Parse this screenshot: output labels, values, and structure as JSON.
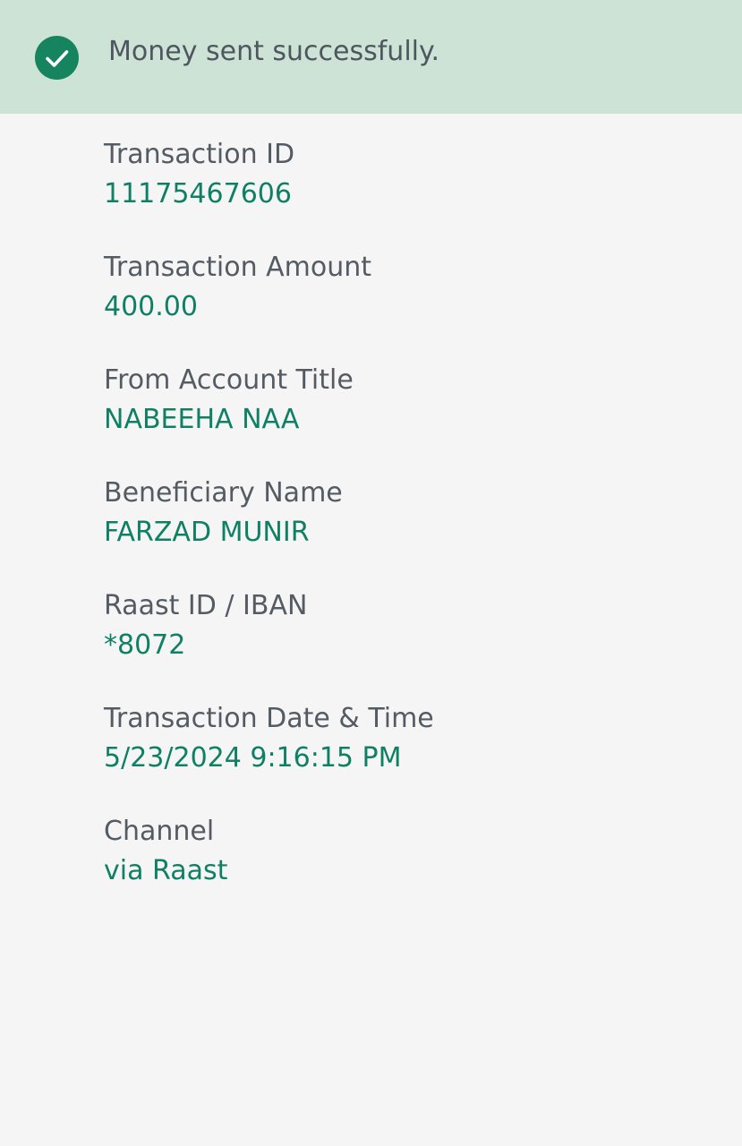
{
  "banner": {
    "message": "Money sent successfully.",
    "icon": "check-circle-icon",
    "background_color": "#cde3d5",
    "icon_color": "#16845f"
  },
  "details": [
    {
      "label": "Transaction ID",
      "value": "11175467606"
    },
    {
      "label": "Transaction Amount",
      "value": "400.00"
    },
    {
      "label": "From Account Title",
      "value": "NABEEHA NAA"
    },
    {
      "label": "Beneficiary Name",
      "value": "FARZAD MUNIR"
    },
    {
      "label": "Raast ID / IBAN",
      "value": "*8072"
    },
    {
      "label": "Transaction Date & Time",
      "value": "5/23/2024 9:16:15 PM"
    },
    {
      "label": "Channel",
      "value": "via Raast"
    }
  ],
  "colors": {
    "label": "#545b63",
    "value": "#0f8064",
    "page_background": "#f5f5f5"
  }
}
